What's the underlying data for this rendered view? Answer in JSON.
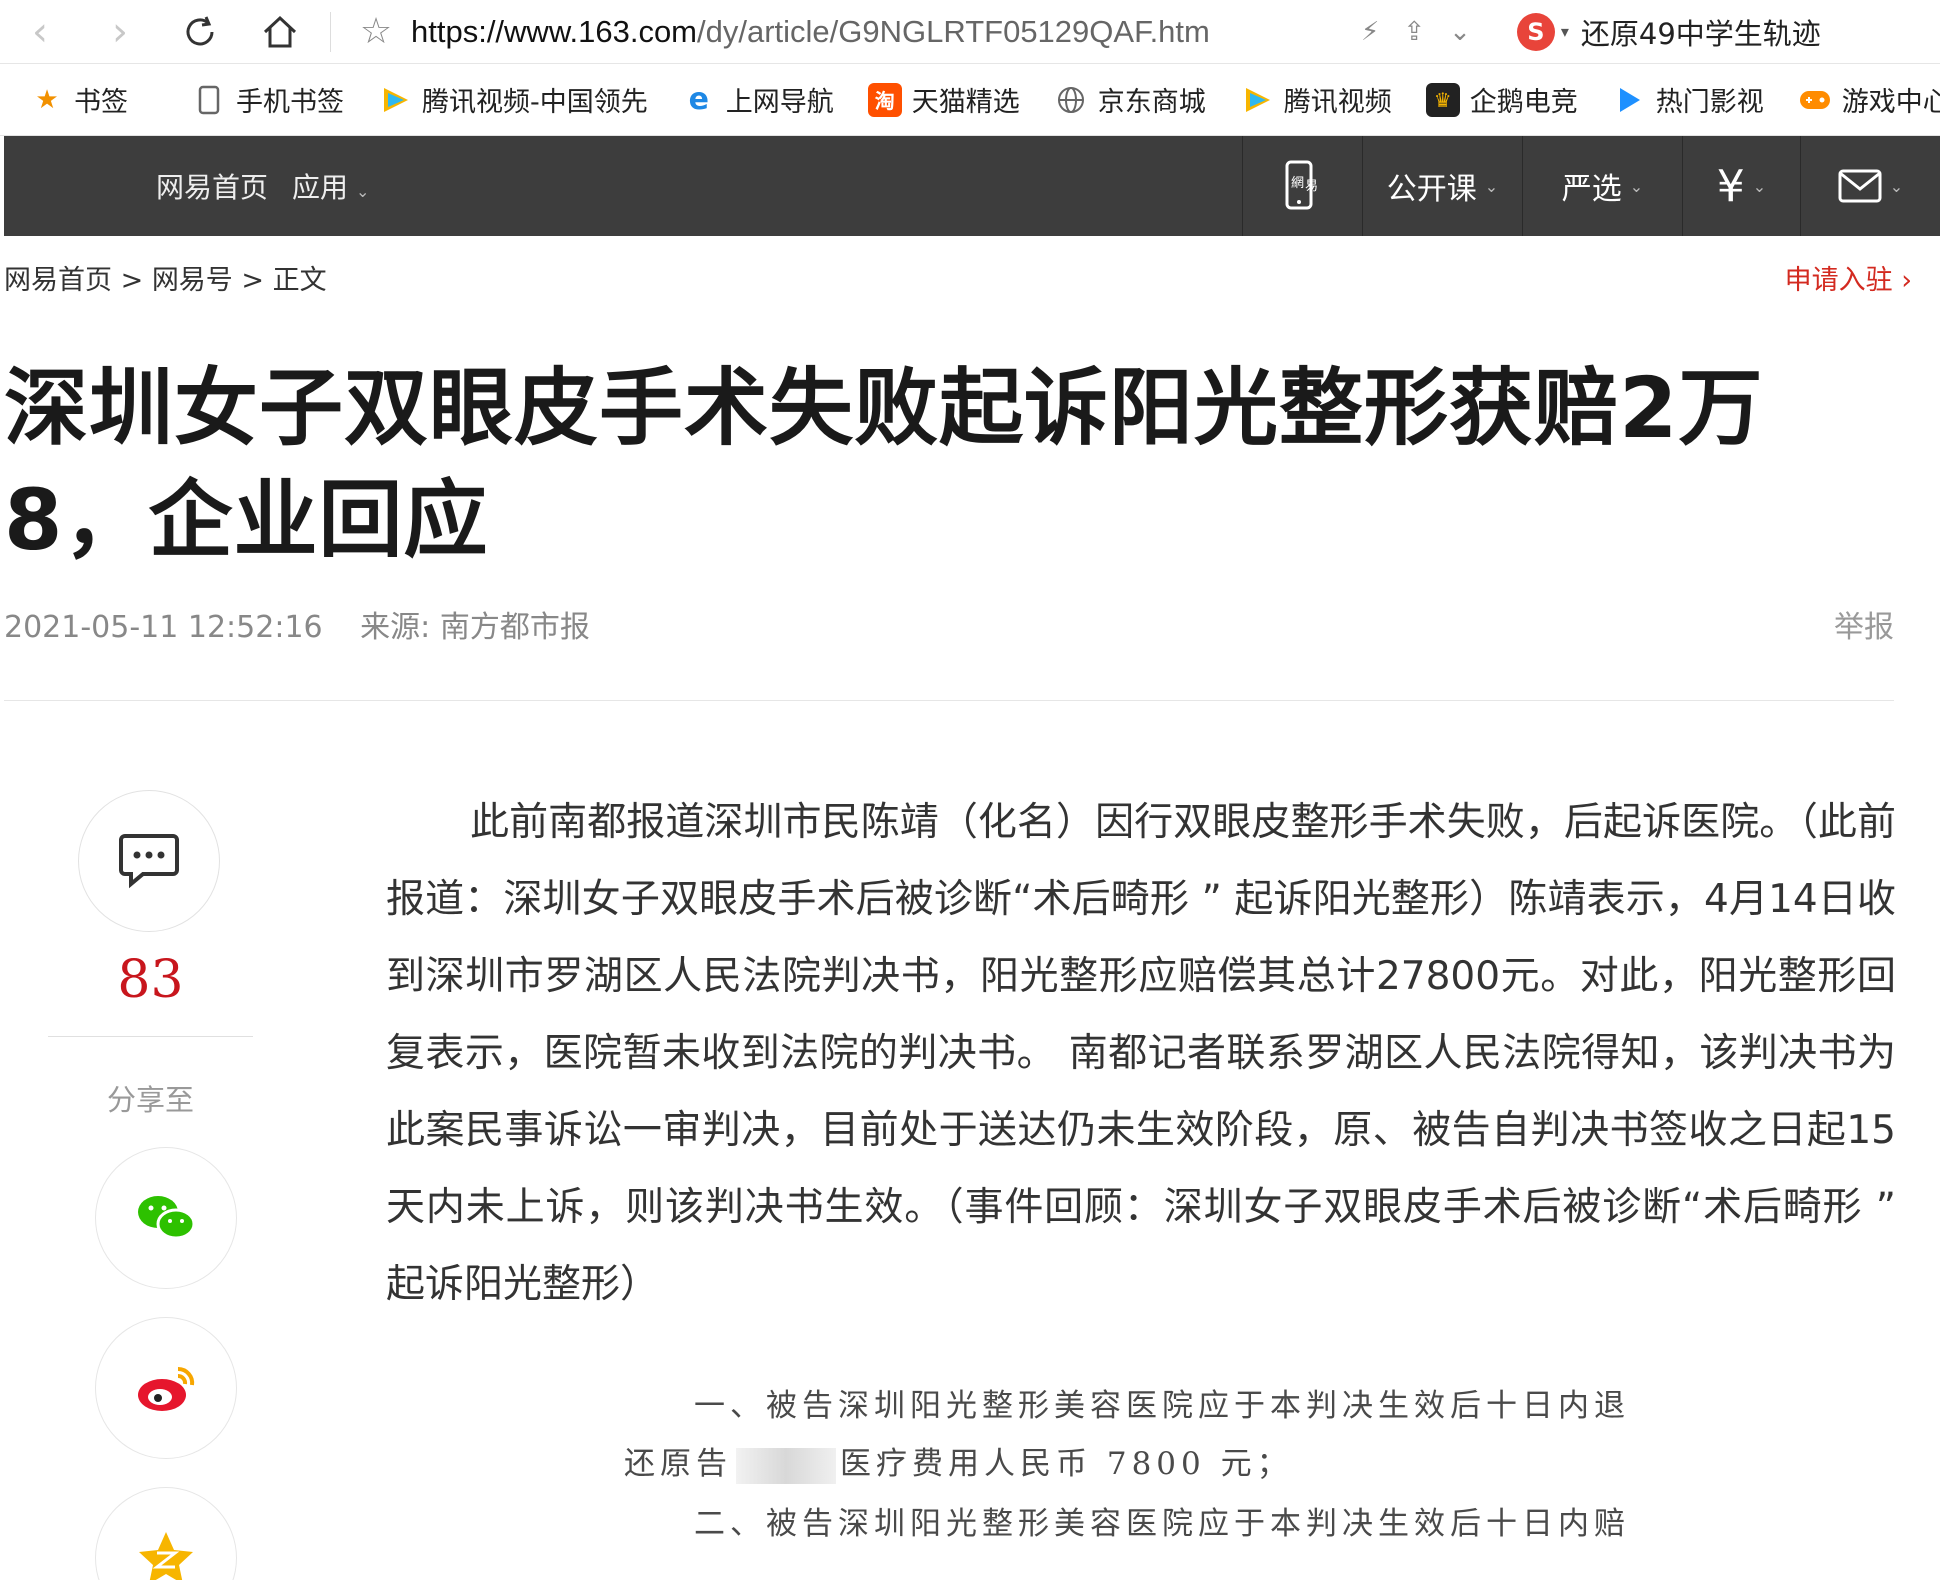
{
  "browser": {
    "url_host": "https://www.163.com",
    "url_path": "/dy/article/G9NGLRTF05129QAF.htm",
    "search_text": "还原49中学生轨迹"
  },
  "bookmarks": [
    {
      "label": "书签",
      "icon": "star-icon",
      "color": "#f29100"
    },
    {
      "label": "手机书签",
      "icon": "phone-icon",
      "color": "#666666"
    },
    {
      "label": "腾讯视频-中国领先",
      "icon": "tencent-video-icon",
      "color": "#2fb8f0"
    },
    {
      "label": "上网导航",
      "icon": "ie-icon",
      "color": "#1e88e5"
    },
    {
      "label": "天猫精选",
      "icon": "taobao-icon",
      "color": "#ff5000"
    },
    {
      "label": "京东商城",
      "icon": "globe-icon",
      "color": "#666666"
    },
    {
      "label": "腾讯视频",
      "icon": "tencent-video-icon",
      "color": "#2fb8f0"
    },
    {
      "label": "企鹅电竞",
      "icon": "penguin-esports-icon",
      "color": "#222222"
    },
    {
      "label": "热门影视",
      "icon": "play-icon",
      "color": "#1e90ff"
    },
    {
      "label": "游戏中心",
      "icon": "gamepad-icon",
      "color": "#ff8c00"
    }
  ],
  "site_nav": {
    "home": "网易首页",
    "apps": "应用",
    "open_course": "公开课",
    "yanxuan": "严选"
  },
  "breadcrumb": {
    "home": "网易首页",
    "sep": ">",
    "dy": "网易号",
    "current": "正文",
    "apply": "申请入驻"
  },
  "article": {
    "title": "深圳女子双眼皮手术失败起诉阳光整形获赔2万8，企业回应",
    "datetime": "2021-05-11 12:52:16",
    "source": "来源: 南方都市报",
    "report": "举报",
    "body": "此前南都报道深圳市民陈靖（化名）因行双眼皮整形手术失败，后起诉医院。（此前报道：深圳女子双眼皮手术后被诊断“术后畸形 ” 起诉阳光整形）陈靖表示，4月14日收到深圳市罗湖区人民法院判决书，阳光整形应赔偿其总计27800元。对此，阳光整形回复表示，医院暂未收到法院的判决书。 南都记者联系罗湖区人民法院得知，该判决书为此案民事诉讼一审判决，目前处于送达仍未生效阶段，原、被告自判决书签收之日起15天内未上诉，则该判决书生效。（事件回顾：深圳女子双眼皮手术后被诊断“术后畸形 ” 起诉阳光整形）"
  },
  "rail": {
    "comment_count": "83",
    "share_label": "分享至"
  },
  "scan": {
    "line1": "一、被告深圳阳光整形美容医院应于本判决生效后十日内退",
    "line2a": "还原告",
    "line2b": "医疗费用人民币 7800 元；",
    "line3": "二、被告深圳阳光整形美容医院应于本判决生效后十日内赔"
  },
  "colors": {
    "nav_bg": "#3d3d3d",
    "accent_red": "#c8161d",
    "wechat_green": "#2dc100",
    "weibo_red": "#e6162d",
    "qzone_yellow": "#f7b500"
  }
}
